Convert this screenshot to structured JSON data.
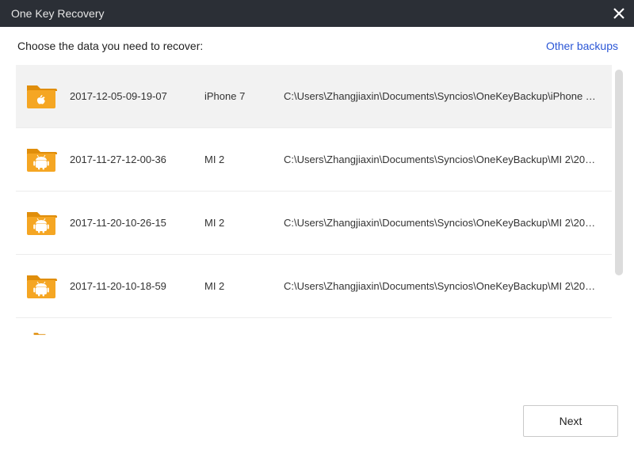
{
  "window": {
    "title": "One Key Recovery"
  },
  "header": {
    "prompt": "Choose the data you need to recover:",
    "other_backups": "Other backups"
  },
  "backups": [
    {
      "date": "2017-12-05-09-19-07",
      "device": "iPhone 7",
      "path": "C:\\Users\\Zhangjiaxin\\Documents\\Syncios\\OneKeyBackup\\iPhone 7\\2017-...",
      "os": "apple",
      "selected": true
    },
    {
      "date": "2017-11-27-12-00-36",
      "device": "MI 2",
      "path": "C:\\Users\\Zhangjiaxin\\Documents\\Syncios\\OneKeyBackup\\MI 2\\2017-11-2...",
      "os": "android",
      "selected": false
    },
    {
      "date": "2017-11-20-10-26-15",
      "device": "MI 2",
      "path": "C:\\Users\\Zhangjiaxin\\Documents\\Syncios\\OneKeyBackup\\MI 2\\2017-11-2...",
      "os": "android",
      "selected": false
    },
    {
      "date": "2017-11-20-10-18-59",
      "device": "MI 2",
      "path": "C:\\Users\\Zhangjiaxin\\Documents\\Syncios\\OneKeyBackup\\MI 2\\2017-11-2...",
      "os": "android",
      "selected": false
    }
  ],
  "footer": {
    "next": "Next"
  },
  "colors": {
    "folder": "#f5a623",
    "folder_dark": "#e08e0b",
    "link": "#2a56d6"
  }
}
